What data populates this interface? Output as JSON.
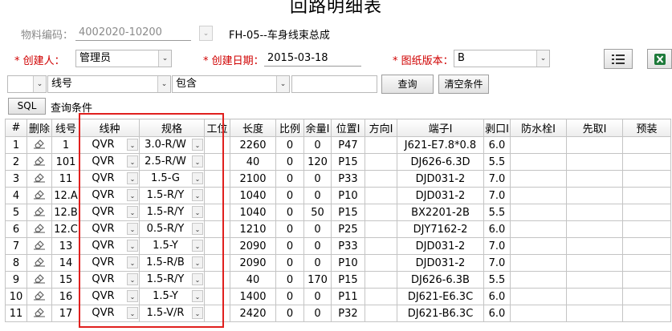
{
  "header": {
    "title": "回路明细表"
  },
  "form": {
    "material_label": "物料编码：",
    "material_value": "4002020-10200",
    "assembly_value": "FH-05--车身线束总成",
    "creator_label": "* 创建人：",
    "creator_value": "管理员",
    "date_label": "* 创建日期：",
    "date_value": "2015-03-18",
    "version_label": "* 图纸版本：",
    "version_value": "B"
  },
  "filter": {
    "logic_value": "",
    "field_value": "线号",
    "operator_value": "包含",
    "text_value": "",
    "query_label": "查询",
    "clear_label": "清空条件",
    "sql_label": "SQL",
    "condition_label": "查询条件"
  },
  "table": {
    "columns": [
      "#",
      "删除",
      "线号",
      "线种",
      "规格",
      "工位",
      "长度",
      "比例",
      "余量I",
      "位置I",
      "方向I",
      "端子I",
      "剥口I",
      "防水栓I",
      "先取I",
      "预装"
    ],
    "rows": [
      {
        "n": "1",
        "line": "1",
        "type": "QVR",
        "spec": "3.0-R/W",
        "station": "",
        "length": "2260",
        "ratio": "0",
        "margin": "0",
        "pos": "P47",
        "dir": "",
        "terminal": "J621-E7.8*0.8",
        "strip": "6.0",
        "seal": "",
        "pre": "",
        "preload": ""
      },
      {
        "n": "2",
        "line": "101",
        "type": "QVR",
        "spec": "2.5-R/W",
        "station": "",
        "length": "40",
        "ratio": "0",
        "margin": "120",
        "pos": "P15",
        "dir": "",
        "terminal": "DJ626-6.3D",
        "strip": "5.5",
        "seal": "",
        "pre": "",
        "preload": ""
      },
      {
        "n": "3",
        "line": "11",
        "type": "QVR",
        "spec": "1.5-G",
        "station": "",
        "length": "2100",
        "ratio": "0",
        "margin": "0",
        "pos": "P33",
        "dir": "",
        "terminal": "DJD031-2",
        "strip": "7.0",
        "seal": "",
        "pre": "",
        "preload": ""
      },
      {
        "n": "4",
        "line": "12.A",
        "type": "QVR",
        "spec": "1.5-R/Y",
        "station": "",
        "length": "1040",
        "ratio": "0",
        "margin": "0",
        "pos": "P10",
        "dir": "",
        "terminal": "DJD031-2",
        "strip": "7.0",
        "seal": "",
        "pre": "",
        "preload": ""
      },
      {
        "n": "5",
        "line": "12.B",
        "type": "QVR",
        "spec": "1.5-R/Y",
        "station": "",
        "length": "1040",
        "ratio": "0",
        "margin": "50",
        "pos": "P15",
        "dir": "",
        "terminal": "BX2201-2B",
        "strip": "5.5",
        "seal": "",
        "pre": "",
        "preload": ""
      },
      {
        "n": "6",
        "line": "12.C",
        "type": "QVR",
        "spec": "0.5-R/Y",
        "station": "",
        "length": "1210",
        "ratio": "0",
        "margin": "0",
        "pos": "P25",
        "dir": "",
        "terminal": "DJY7162-2",
        "strip": "6.0",
        "seal": "",
        "pre": "",
        "preload": ""
      },
      {
        "n": "7",
        "line": "13",
        "type": "QVR",
        "spec": "1.5-Y",
        "station": "",
        "length": "2090",
        "ratio": "0",
        "margin": "0",
        "pos": "P33",
        "dir": "",
        "terminal": "DJD031-2",
        "strip": "7.0",
        "seal": "",
        "pre": "",
        "preload": ""
      },
      {
        "n": "8",
        "line": "14",
        "type": "QVR",
        "spec": "1.5-R/B",
        "station": "",
        "length": "2090",
        "ratio": "0",
        "margin": "0",
        "pos": "P10",
        "dir": "",
        "terminal": "DJD031-2",
        "strip": "7.0",
        "seal": "",
        "pre": "",
        "preload": ""
      },
      {
        "n": "9",
        "line": "15",
        "type": "QVR",
        "spec": "1.5-R/Y",
        "station": "",
        "length": "40",
        "ratio": "0",
        "margin": "170",
        "pos": "P15",
        "dir": "",
        "terminal": "DJ626-6.3B",
        "strip": "5.5",
        "seal": "",
        "pre": "",
        "preload": ""
      },
      {
        "n": "10",
        "line": "16",
        "type": "QVR",
        "spec": "1.5-Y",
        "station": "",
        "length": "1400",
        "ratio": "0",
        "margin": "0",
        "pos": "P11",
        "dir": "",
        "terminal": "DJ621-E6.3C",
        "strip": "6.0",
        "seal": "",
        "pre": "",
        "preload": ""
      },
      {
        "n": "11",
        "line": "17",
        "type": "QVR",
        "spec": "1.5-V/R",
        "station": "",
        "length": "2420",
        "ratio": "0",
        "margin": "0",
        "pos": "P32",
        "dir": "",
        "terminal": "DJ621-B6.3C",
        "strip": "6.0",
        "seal": "",
        "pre": "",
        "preload": ""
      }
    ]
  },
  "colors": {
    "highlight": "#e0201e",
    "required": "#d00000",
    "excel": "#1d7a3a"
  },
  "icons": {
    "delete": "eraser-icon",
    "list": "list-icon",
    "excel": "excel-icon"
  }
}
